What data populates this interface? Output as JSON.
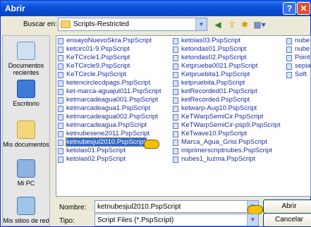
{
  "window": {
    "title": "Abrir",
    "help_label": "?",
    "close_label": "✕"
  },
  "lookin": {
    "label": "Buscar en:",
    "value": "Scripts-Restricted"
  },
  "sidebar": [
    {
      "label": "Documentos recientes",
      "icon": "recent-documents-icon"
    },
    {
      "label": "Escritorio",
      "icon": "desktop-icon"
    },
    {
      "label": "Mis documentos",
      "icon": "my-documents-icon"
    },
    {
      "label": "Mi PC",
      "icon": "my-computer-icon"
    },
    {
      "label": "Mis sitios de red",
      "icon": "network-places-icon"
    }
  ],
  "files": {
    "col1": [
      "ensayoNuevoSkra.PspScript",
      "ketcirc01-9.PspScript",
      "KeTCircle1.PspScript",
      "KeTCircle9.PspScript",
      "KeTCircle.PspScript",
      "ketencirclecdpags.PspScript",
      "ket-marca-aguajul011.PspScript",
      "ketmarcadeagua001.PspScript",
      "ketmarcadeagua1.PspScript",
      "ketmarcadeagua002.PspScript",
      "ketmarcadeagua.PspScript",
      "ketnubesene2011.PspScript",
      "ketnubesjul2010.PspScript",
      "ketolas01.PspScript",
      "ketolas02.PspScript"
    ],
    "col2": [
      "ketolas03.PspScript",
      "ketondas01.PspScript",
      "ketondas02.PspScript",
      "Ketprueba0021.PspScript",
      "Ketpruebita1.PspScript",
      "ketpruebita.PspScript",
      "ketRecorded01.PspScript",
      "ketRecorded.PspScript",
      "ketwarp-Aug10.PspScript",
      "KeTWarpSemiCir.PspScript",
      "KeTWarpSemiCir-psp9.PspScript",
      "KeTwave10.PspScript",
      "Marca_Agua_Grisi.PspScript",
      "miprimerscriptnubes.PspScript",
      "nubes1_luzma.PspScript"
    ],
    "col3": [
      "nube",
      "nube",
      "Point",
      "sepia",
      "Soft"
    ]
  },
  "selected_file": "ketnubesjul2010.PspScript",
  "filename": {
    "label": "Nombre:",
    "value": "ketnubesjul2010.PspScript"
  },
  "filetype": {
    "label": "Tipo:",
    "value": "Script Files (*.PspScript)"
  },
  "buttons": {
    "open": "Abrir",
    "cancel": "Cancelar"
  },
  "nav_icons": [
    "back-icon",
    "up-folder-icon",
    "new-folder-icon",
    "views-menu-icon"
  ],
  "colors": {
    "titlebar": "#0a50d8",
    "selection": "#316ac5",
    "dialog_bg": "#ece9d8"
  }
}
